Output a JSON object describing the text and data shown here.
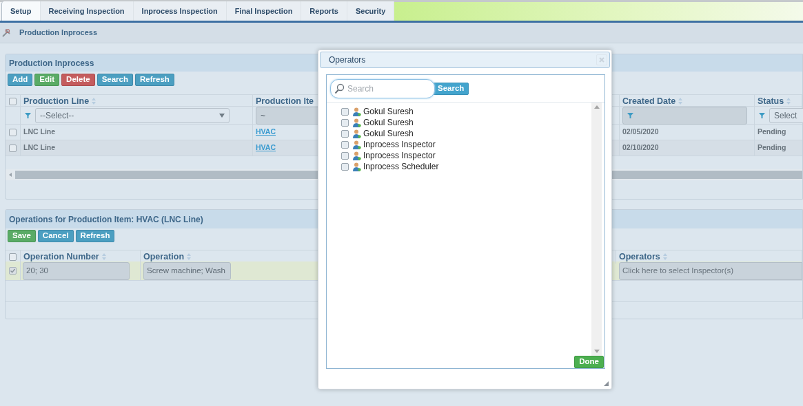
{
  "tabs": [
    {
      "label": "Setup",
      "selected": true
    },
    {
      "label": "Receiving Inspection",
      "selected": false
    },
    {
      "label": "Inprocess Inspection",
      "selected": false
    },
    {
      "label": "Final Inspection",
      "selected": false
    },
    {
      "label": "Reports",
      "selected": false
    },
    {
      "label": "Security",
      "selected": false
    }
  ],
  "breadcrumb": "Production Inprocess",
  "production_panel": {
    "title": "Production Inprocess",
    "toolbar": [
      {
        "label": "Add",
        "kind": "info"
      },
      {
        "label": "Edit",
        "kind": "success"
      },
      {
        "label": "Delete",
        "kind": "danger"
      },
      {
        "label": "Search",
        "kind": "info"
      },
      {
        "label": "Refresh",
        "kind": "info"
      }
    ],
    "select_all_checked": false,
    "columns": [
      {
        "label": "Production Line",
        "filter": {
          "kind": "select",
          "value": "--Select--"
        }
      },
      {
        "label": "Production Ite",
        "filter": {
          "kind": "input",
          "value": "~"
        }
      },
      {
        "label": "Created Date",
        "filter": {
          "kind": "input"
        }
      },
      {
        "label": "Status",
        "filter": {
          "kind": "select",
          "value": "Select"
        }
      }
    ],
    "rows": [
      {
        "checked": false,
        "production_line": "LNC Line",
        "production_item": "HVAC",
        "created_date": "02/05/2020",
        "status": "Pending"
      },
      {
        "checked": false,
        "production_line": "LNC Line",
        "production_item": "HVAC",
        "created_date": "02/10/2020",
        "status": "Pending"
      }
    ]
  },
  "operations_panel": {
    "title": "Operations for Production Item: HVAC (LNC Line)",
    "toolbar": [
      {
        "label": "Save",
        "kind": "success"
      },
      {
        "label": "Cancel",
        "kind": "info"
      },
      {
        "label": "Refresh",
        "kind": "info"
      }
    ],
    "select_all_checked": false,
    "columns": [
      {
        "label": "Operation Number"
      },
      {
        "label": "Operation"
      },
      {
        "label": "Operators"
      }
    ],
    "rows": [
      {
        "checked": true,
        "operation_number": "20; 30",
        "operation": "Screw machine; Wash",
        "operators_placeholder": "Click here to select Inspector(s)"
      }
    ]
  },
  "dialog": {
    "title": "Operators",
    "search": {
      "placeholder": "Search"
    },
    "search_button": "Search",
    "items": [
      {
        "name": "Gokul Suresh",
        "checked": false
      },
      {
        "name": "Gokul Suresh",
        "checked": false
      },
      {
        "name": "Gokul Suresh",
        "checked": false
      },
      {
        "name": "Inprocess Inspector",
        "checked": false
      },
      {
        "name": "Inprocess Inspector",
        "checked": false
      },
      {
        "name": "Inprocess Scheduler",
        "checked": false
      }
    ],
    "done_button": "Done"
  }
}
